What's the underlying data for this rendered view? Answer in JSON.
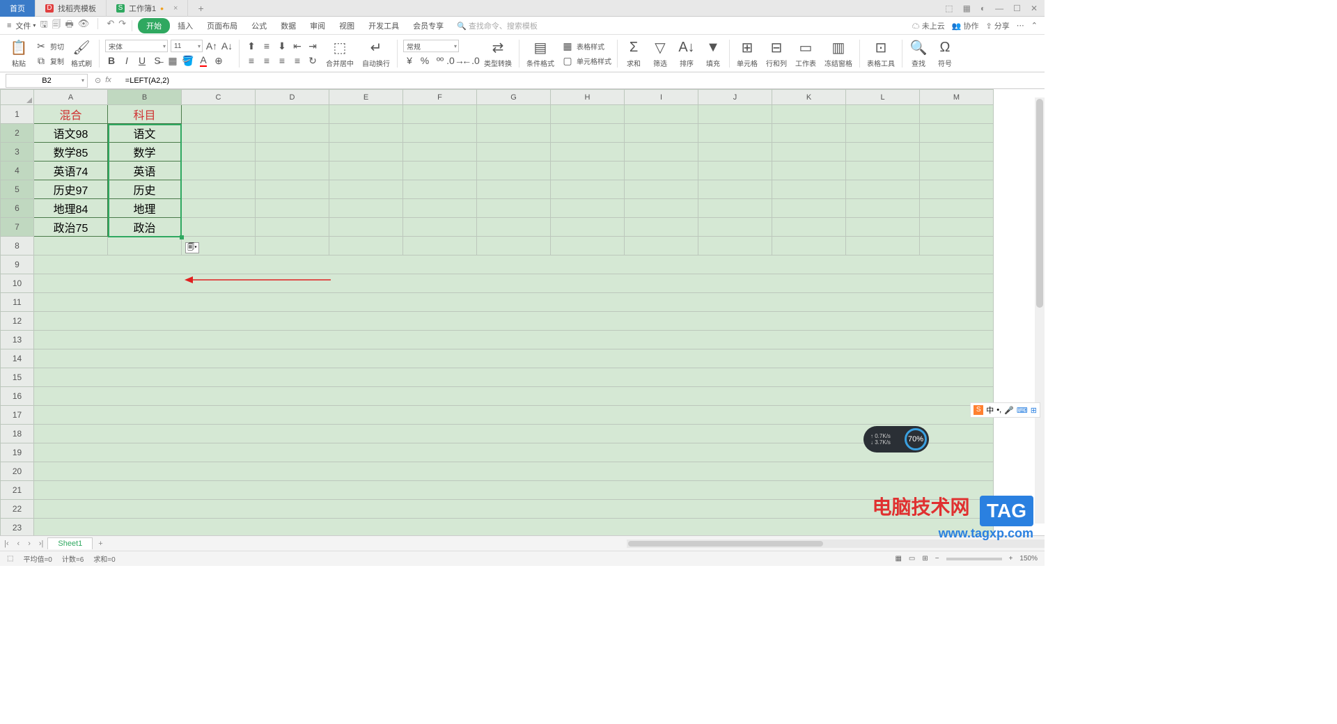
{
  "tabs": {
    "home": "首页",
    "t1": "找稻壳模板",
    "t2": "工作簿1"
  },
  "menu": {
    "file": "文件",
    "start": "开始",
    "insert": "插入",
    "layout": "页面布局",
    "formula": "公式",
    "data": "数据",
    "review": "审阅",
    "view": "视图",
    "dev": "开发工具",
    "member": "会员专享",
    "search_cmd": "查找命令、",
    "search_tpl": "搜索模板",
    "cloud": "未上云",
    "coop": "协作",
    "share": "分享"
  },
  "ribbon": {
    "paste": "粘贴",
    "cut": "剪切",
    "copy": "复制",
    "fmt": "格式刷",
    "font": "宋体",
    "size": "11",
    "merge": "合并居中",
    "wrap": "自动换行",
    "numfmt": "常规",
    "typeconv": "类型转换",
    "condfmt": "条件格式",
    "tablestyle": "表格样式",
    "cellstyle": "单元格样式",
    "sum": "求和",
    "filter": "筛选",
    "sort": "排序",
    "fill": "填充",
    "cell": "单元格",
    "rowcol": "行和列",
    "sheet": "工作表",
    "freeze": "冻结窗格",
    "tabletool": "表格工具",
    "find": "查找",
    "symbol": "符号"
  },
  "namebox": "B2",
  "formula": "=LEFT(A2,2)",
  "cols": [
    "A",
    "B",
    "C",
    "D",
    "E",
    "F",
    "G",
    "H",
    "I",
    "J",
    "K",
    "L",
    "M"
  ],
  "rows": [
    "1",
    "2",
    "3",
    "4",
    "5",
    "6",
    "7",
    "8",
    "9",
    "10",
    "11",
    "12",
    "13",
    "14",
    "15",
    "16",
    "17",
    "18",
    "19",
    "20",
    "21",
    "22",
    "23"
  ],
  "data": {
    "a1": "混合",
    "b1": "科目",
    "a2": "语文98",
    "b2": "语文",
    "a3": "数学85",
    "b3": "数学",
    "a4": "英语74",
    "b4": "英语",
    "a5": "历史97",
    "b5": "历史",
    "a6": "地理84",
    "b6": "地理",
    "a7": "政治75",
    "b7": "政治"
  },
  "sheet": "Sheet1",
  "status": {
    "avg": "平均值=0",
    "count": "计数=6",
    "sum": "求和=0",
    "zoom": "150%"
  },
  "speed": {
    "up": "0.7K/s",
    "down": "3.7K/s",
    "pct": "70%"
  },
  "ime": "中",
  "wm": {
    "t1": "电脑技术网",
    "t2": "www.tagxp.com",
    "tag": "TAG"
  }
}
